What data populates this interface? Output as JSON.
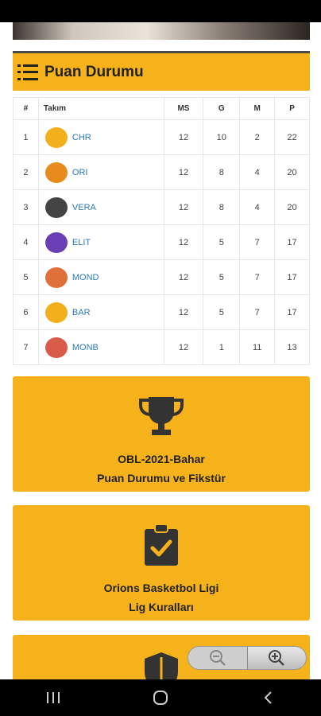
{
  "standings": {
    "title": "Puan Durumu",
    "columns": {
      "rank": "#",
      "team": "Takım",
      "ms": "MS",
      "g": "G",
      "m": "M",
      "p": "P"
    },
    "rows": [
      {
        "rank": "1",
        "team": "CHR",
        "ms": "12",
        "g": "10",
        "m": "2",
        "p": "22",
        "logo_color": "#f2b01c"
      },
      {
        "rank": "2",
        "team": "ORI",
        "ms": "12",
        "g": "8",
        "m": "4",
        "p": "20",
        "logo_color": "#e88b1d"
      },
      {
        "rank": "3",
        "team": "VERA",
        "ms": "12",
        "g": "8",
        "m": "4",
        "p": "20",
        "logo_color": "#444444"
      },
      {
        "rank": "4",
        "team": "ELIT",
        "ms": "12",
        "g": "5",
        "m": "7",
        "p": "17",
        "logo_color": "#6a3fb5"
      },
      {
        "rank": "5",
        "team": "MOND",
        "ms": "12",
        "g": "5",
        "m": "7",
        "p": "17",
        "logo_color": "#e0703a"
      },
      {
        "rank": "6",
        "team": "BAR",
        "ms": "12",
        "g": "5",
        "m": "7",
        "p": "17",
        "logo_color": "#f2b01c"
      },
      {
        "rank": "7",
        "team": "MONB",
        "ms": "12",
        "g": "1",
        "m": "11",
        "p": "13",
        "logo_color": "#d95b4a"
      }
    ]
  },
  "cards": {
    "fixture": {
      "line1": "OBL-2021-Bahar",
      "line2": "Puan Durumu ve Fikstür",
      "icon": "trophy-icon"
    },
    "rules": {
      "line1": "Orions Basketbol Ligi",
      "line2": "Lig Kuralları",
      "icon": "clipboard-check-icon"
    },
    "third": {
      "icon": "shield-icon"
    }
  },
  "zoom": {
    "out_icon": "zoom-out-icon",
    "in_icon": "zoom-in-icon"
  },
  "colors": {
    "accent": "#f6b21b",
    "link": "#2a7ab8"
  }
}
